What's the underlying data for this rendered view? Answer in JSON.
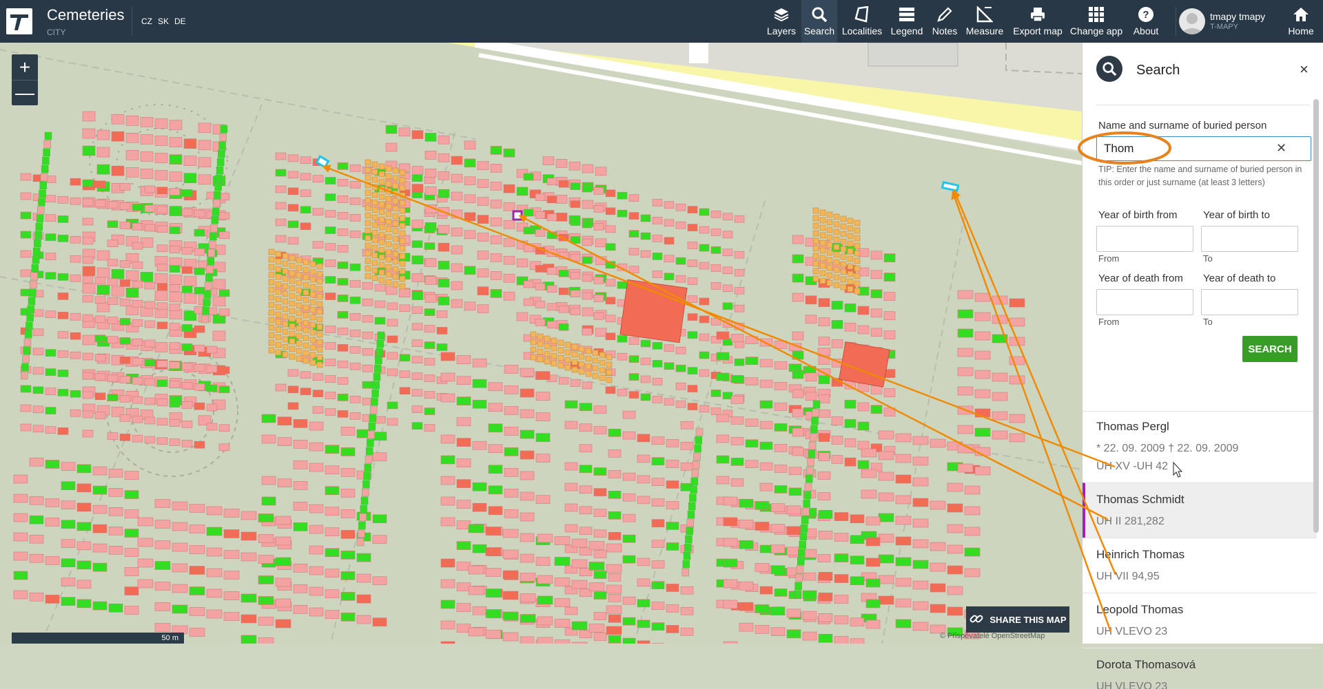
{
  "app": {
    "title": "Cemeteries",
    "subtitle": "CITY",
    "languages": [
      "CZ",
      "SK",
      "DE"
    ]
  },
  "toolbar": {
    "items": [
      {
        "label": "Layers",
        "icon": "layers-icon"
      },
      {
        "label": "Search",
        "icon": "search-icon",
        "active": true
      },
      {
        "label": "Localities",
        "icon": "localities-icon"
      },
      {
        "label": "Legend",
        "icon": "legend-icon"
      },
      {
        "label": "Notes",
        "icon": "notes-icon"
      },
      {
        "label": "Measure",
        "icon": "measure-icon"
      },
      {
        "label": "Export map",
        "icon": "print-icon"
      },
      {
        "label": "Change app",
        "icon": "grid-icon"
      },
      {
        "label": "About",
        "icon": "help-icon"
      }
    ],
    "home_label": "Home"
  },
  "user": {
    "name": "tmapy tmapy",
    "org": "T-MAPY"
  },
  "map": {
    "zoom_in": "+",
    "zoom_out": "—",
    "share_label": "SHARE THIS MAP",
    "attribution": "© Přispěvatelé OpenStreetMap",
    "scale_label": "50 m"
  },
  "search_panel": {
    "title": "Search",
    "close": "×",
    "name_label": "Name and surname of buried person",
    "name_value": "Thom",
    "tip": "TIP: Enter the name and surname of buried person in this order or just surname (at least 3 letters)",
    "birth_from_label": "Year of birth from",
    "birth_to_label": "Year of birth to",
    "death_from_label": "Year of death from",
    "death_to_label": "Year of death to",
    "from_hint": "From",
    "to_hint": "To",
    "button": "SEARCH",
    "results": [
      {
        "name": "Thomas Pergl",
        "dates": "* 22. 09. 2009 † 22. 09. 2009",
        "place": "UH XV -UH 42"
      },
      {
        "name": "Thomas Schmidt",
        "place": "UH II 281,282",
        "selected": true
      },
      {
        "name": "Heinrich Thomas",
        "place": "UH VII 94,95"
      },
      {
        "name": "Leopold Thomas",
        "place": "UH VLEVO 23"
      },
      {
        "name": "Dorota Thomasová",
        "place": "UH VLEVO 23"
      }
    ]
  },
  "colors": {
    "topbar": "#293846",
    "grave_occupied": "#f4a3a3",
    "grave_free": "#33dd22",
    "grave_block": "#f26b55",
    "urn_grave": "#f3b55a",
    "annotation": "#f08a00",
    "selection": "#9b27af",
    "highlight": "#22c4e8"
  }
}
